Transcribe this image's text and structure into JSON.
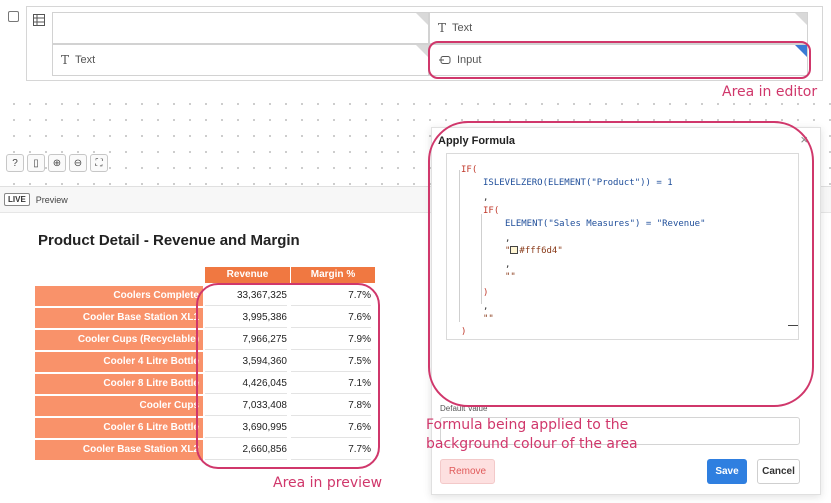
{
  "editor": {
    "cells": [
      {
        "label": "Text",
        "icon": "text-icon"
      },
      {
        "label": "Text",
        "icon": "text-icon"
      },
      {
        "label": "Input",
        "icon": "input-icon"
      }
    ],
    "toolbar": [
      "help-icon",
      "panel-icon",
      "zoom-in-icon",
      "zoom-out-icon",
      "fit-icon"
    ]
  },
  "preview": {
    "live_badge": "LIVE",
    "tab_label": "Preview"
  },
  "report": {
    "title": "Product Detail - Revenue and Margin",
    "columns": [
      "Revenue",
      "Margin %"
    ],
    "rows": [
      {
        "name": "Coolers Complete",
        "revenue": "33,367,325",
        "margin": "7.7%"
      },
      {
        "name": "Cooler Base Station XL1",
        "revenue": "3,995,386",
        "margin": "7.6%"
      },
      {
        "name": "Cooler Cups (Recyclable)",
        "revenue": "7,966,275",
        "margin": "7.9%"
      },
      {
        "name": "Cooler 4 Litre Bottle",
        "revenue": "3,594,360",
        "margin": "7.5%"
      },
      {
        "name": "Cooler 8 Litre Bottle",
        "revenue": "4,426,045",
        "margin": "7.1%"
      },
      {
        "name": "Cooler Cups",
        "revenue": "7,033,408",
        "margin": "7.8%"
      },
      {
        "name": "Cooler 6 Litre Bottle",
        "revenue": "3,690,995",
        "margin": "7.6%"
      },
      {
        "name": "Cooler Base Station XL2",
        "revenue": "2,660,856",
        "margin": "7.7%"
      }
    ],
    "header_color": "#f07841",
    "row_color": "#f9926a"
  },
  "dialog": {
    "title": "Apply Formula",
    "close_glyph": "×",
    "formula": {
      "l1": "IF(",
      "l2": "ISLEVELZERO(ELEMENT(\"Product\")) = 1",
      "l3": ",",
      "l4": "IF(",
      "l5": "ELEMENT(\"Sales Measures\") = \"Revenue\"",
      "l6": ",",
      "l7_color": "#fff6d4",
      "l8": ",",
      "l9": "\"\"",
      "l10": ")",
      "l11": ",",
      "l12": "\"\"",
      "l13": ")"
    },
    "default_value_label": "Default Value",
    "remove_label": "Remove",
    "save_label": "Save",
    "cancel_label": "Cancel"
  },
  "annotations": {
    "editor_note": "Area in editor",
    "preview_note": "Area in preview",
    "formula_note_line1": "Formula being applied to the",
    "formula_note_line2": "background colour of the area",
    "color": "#d0376b"
  }
}
